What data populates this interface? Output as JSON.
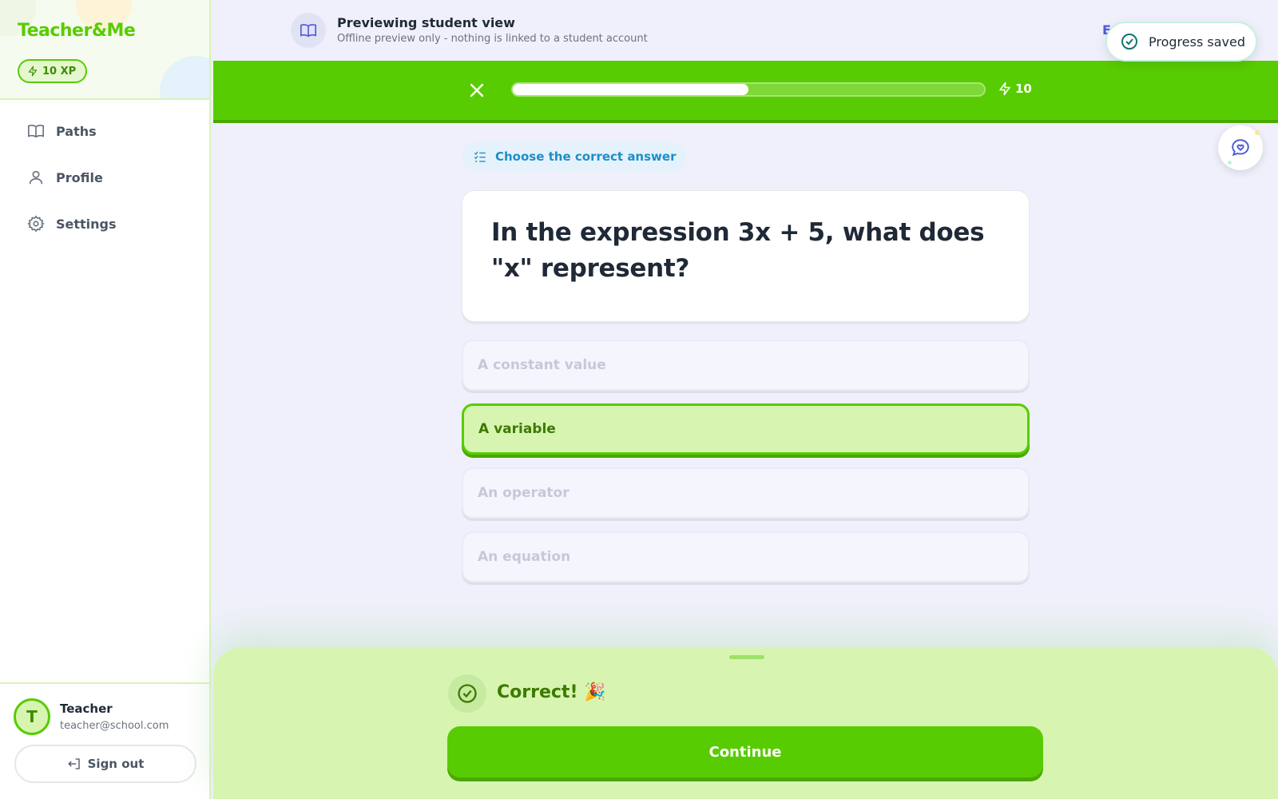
{
  "brand": {
    "name": "Teacher&Me",
    "xp_badge": "10 XP"
  },
  "sidebar": {
    "items": [
      {
        "label": "Paths",
        "icon": "book-open-icon"
      },
      {
        "label": "Profile",
        "icon": "user-icon"
      },
      {
        "label": "Settings",
        "icon": "gear-icon"
      }
    ]
  },
  "user": {
    "initial": "T",
    "name": "Teacher",
    "email": "teacher@school.com",
    "signout_label": "Sign out"
  },
  "preview": {
    "title": "Previewing student view",
    "subtitle": "Offline preview only - nothing is linked to a student account",
    "exit_label": "E"
  },
  "lesson": {
    "progress_percent": 50,
    "xp": "10"
  },
  "toast": {
    "message": "Progress saved"
  },
  "question": {
    "type_label": "Choose the correct answer",
    "text": "In the expression 3x + 5, what does \"x\" represent?",
    "options": [
      {
        "label": "A constant value",
        "state": "disabled"
      },
      {
        "label": "A variable",
        "state": "correct"
      },
      {
        "label": "An operator",
        "state": "disabled"
      },
      {
        "label": "An equation",
        "state": "disabled"
      }
    ]
  },
  "feedback": {
    "message": "Correct! 🎉",
    "continue_label": "Continue"
  },
  "colors": {
    "primary_green": "#58cc02",
    "accent_blue": "#4f5bd5",
    "question_type_blue": "#1b8fc9"
  }
}
